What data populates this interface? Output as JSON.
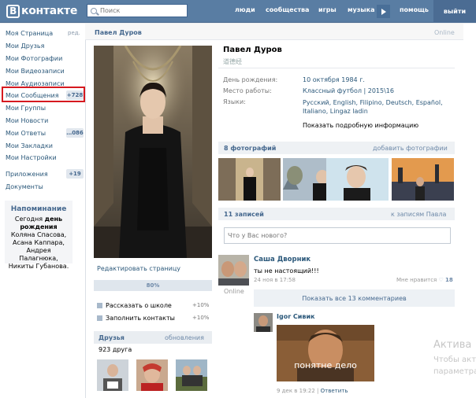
{
  "header": {
    "logo_letter": "В",
    "logo_text": "контакте",
    "search_placeholder": "Поиск",
    "nav": [
      "люди",
      "сообщества",
      "игры",
      "музыка",
      "помощь"
    ],
    "logout": "выйти"
  },
  "leftmenu": {
    "items": [
      {
        "label": "Моя Страница"
      },
      {
        "label": "Мои Друзья"
      },
      {
        "label": "Мои Фотографии"
      },
      {
        "label": "Мои Видеозаписи"
      },
      {
        "label": "Мои Аудиозаписи"
      },
      {
        "label": "Мои Сообщения",
        "badge": "+728"
      },
      {
        "label": "Мои Группы"
      },
      {
        "label": "Мои Новости"
      },
      {
        "label": "Мои Ответы",
        "badge": "…086"
      },
      {
        "label": "Мои Закладки"
      },
      {
        "label": "Мои Настройки"
      },
      {
        "label": "Приложения",
        "badge": "+19"
      },
      {
        "label": "Документы"
      }
    ],
    "edit": "ред.",
    "reminder": {
      "title": "Напоминание",
      "body_prefix": "Сегодня ",
      "body_bold": "день рождения",
      "body_rest": " Коляна Спасова, Асана Каппара, Андрея Палагнюка, Никиты Губанова."
    }
  },
  "page": {
    "header_name": "Павел Дуров",
    "header_status": "Online",
    "edit_page": "Редактировать страницу",
    "progress": "80%",
    "progress_value": 0.8,
    "tasks": [
      {
        "label": "Рассказать о школе",
        "pct": "+10%"
      },
      {
        "label": "Заполнить контакты",
        "pct": "+10%"
      }
    ],
    "friends": {
      "title": "Друзья",
      "update": "обновления",
      "count": "923 друга"
    }
  },
  "profile": {
    "name": "Павел Дуров",
    "alias": "道德经",
    "info": [
      {
        "label": "День рождения:",
        "value": "10 октября 1984 г."
      },
      {
        "label": "Место работы:",
        "value": "Классный футбол | 2015\\16"
      },
      {
        "label": "Языки:",
        "value": "Русский, English, Filipino, Deutsch, Español, Italiano, Lingaz ladin"
      }
    ],
    "more_info": "Показать подробную информацию"
  },
  "photos": {
    "title": "8 фотографий",
    "add": "добавить фотографии"
  },
  "wall": {
    "title": "11 записей",
    "link": "к записям Павла",
    "placeholder": "Что у Вас нового?",
    "post": {
      "author": "Саша Дворник",
      "text": "ты не настоящий!!!",
      "date": "24 ноя в 17:58",
      "like_label": "Мне нравится",
      "likes": "18",
      "online": "Online"
    },
    "show_all": "Показать все 13 комментариев",
    "comment": {
      "author": "Igor Сивик",
      "image_caption": "понятне дело",
      "date": "9 дек в 19:22",
      "reply": "Ответить"
    }
  },
  "watermark": {
    "line1": "Актива",
    "line2": "Чтобы акт",
    "line3": "параметра"
  }
}
